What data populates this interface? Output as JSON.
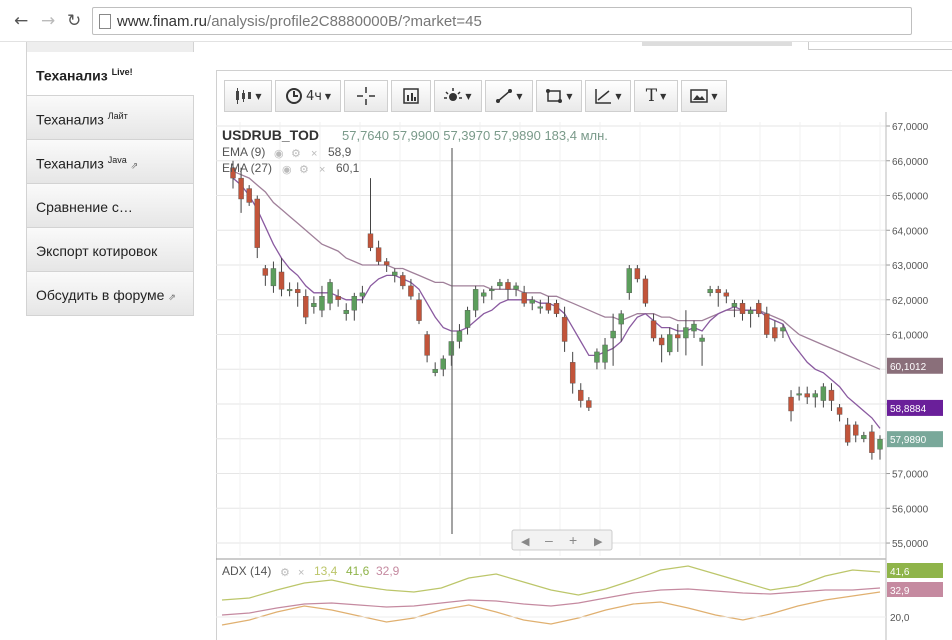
{
  "browser": {
    "back_icon": "back-arrow-icon",
    "forward_icon": "forward-arrow-icon",
    "reload_icon": "reload-icon",
    "url_host": "www.finam.ru",
    "url_path": "/analysis/profile2C8880000B/?market=45"
  },
  "sidebar": {
    "items": [
      {
        "label": "Теханализ",
        "sup": "Live!"
      },
      {
        "label": "Теханализ",
        "sup": "Лайт"
      },
      {
        "label": "Теханализ",
        "sup": "Java",
        "ext": "⇗"
      },
      {
        "label": "Сравнение с…"
      },
      {
        "label": "Экспорт котировок"
      },
      {
        "label": "Обсудить в форуме",
        "ext": "⇗"
      }
    ]
  },
  "toolbar": {
    "period_label": "4ч",
    "text_tool_label": "T"
  },
  "chart_data": {
    "type": "candlestick",
    "ticker": "USDRUB_TOD",
    "ohlc_header": [
      "57,7640",
      "57,9900",
      "57,3970",
      "57,9890",
      "183,4 млн."
    ],
    "indicators": [
      {
        "name": "EMA (9)",
        "value": "58,9",
        "color": "#8a5aa0"
      },
      {
        "name": "EMA (27)",
        "value": "60,1",
        "color": "#a0809a"
      }
    ],
    "ylim": [
      54.8,
      67.0
    ],
    "y_ticks": [
      {
        "value": 67,
        "label": "67,0000"
      },
      {
        "value": 66,
        "label": "66,0000"
      },
      {
        "value": 65,
        "label": "65,0000"
      },
      {
        "value": 64,
        "label": "64,0000"
      },
      {
        "value": 63,
        "label": "63,0000"
      },
      {
        "value": 62,
        "label": "62,0000"
      },
      {
        "value": 61,
        "label": "61,0000"
      },
      {
        "value": 59,
        "label": "59,0000"
      },
      {
        "value": 57,
        "label": "57,0000"
      },
      {
        "value": 56,
        "label": "56,0000"
      },
      {
        "value": 55,
        "label": "55,0000"
      }
    ],
    "price_tags": [
      {
        "value": 60.1012,
        "label": "60,1012",
        "color": "#8a6f7a"
      },
      {
        "value": 58.8884,
        "label": "58,8884",
        "color": "#6a1f9a"
      },
      {
        "value": 57.989,
        "label": "57,9890",
        "color": "#79a89a"
      }
    ],
    "candles": [
      [
        65.8,
        66.0,
        65.2,
        65.5
      ],
      [
        65.5,
        65.8,
        64.5,
        64.9
      ],
      [
        65.2,
        65.3,
        64.7,
        64.8
      ],
      [
        64.9,
        65.0,
        63.2,
        63.5
      ],
      [
        62.9,
        63.0,
        62.4,
        62.7
      ],
      [
        62.4,
        63.1,
        62.2,
        62.9
      ],
      [
        62.8,
        63.2,
        62.1,
        62.3
      ],
      [
        62.3,
        62.5,
        62.1,
        62.3
      ],
      [
        62.3,
        62.5,
        61.8,
        62.2
      ],
      [
        62.1,
        62.3,
        61.3,
        61.5
      ],
      [
        61.8,
        62.1,
        61.6,
        61.9
      ],
      [
        61.7,
        62.4,
        61.5,
        62.1
      ],
      [
        61.9,
        62.6,
        61.7,
        62.5
      ],
      [
        62.1,
        62.3,
        61.8,
        62.0
      ],
      [
        61.6,
        61.9,
        61.4,
        61.7
      ],
      [
        61.7,
        62.2,
        61.4,
        62.1
      ],
      [
        62.1,
        62.4,
        61.9,
        62.2
      ],
      [
        63.9,
        65.5,
        63.4,
        63.5
      ],
      [
        63.5,
        63.7,
        63.0,
        63.1
      ],
      [
        63.1,
        63.2,
        62.8,
        63.0
      ],
      [
        62.7,
        62.9,
        62.5,
        62.8
      ],
      [
        62.7,
        62.8,
        62.3,
        62.4
      ],
      [
        62.4,
        62.6,
        62.0,
        62.1
      ],
      [
        62.0,
        62.2,
        61.3,
        61.4
      ],
      [
        61.0,
        61.1,
        60.2,
        60.4
      ],
      [
        59.9,
        60.2,
        59.8,
        60.0
      ],
      [
        60.0,
        60.4,
        59.8,
        60.3
      ],
      [
        60.4,
        60.8,
        60.1,
        60.8
      ],
      [
        60.8,
        61.3,
        60.6,
        61.1
      ],
      [
        61.2,
        61.8,
        61.0,
        61.7
      ],
      [
        61.7,
        62.4,
        61.5,
        62.3
      ],
      [
        62.1,
        62.3,
        61.9,
        62.2
      ],
      [
        62.3,
        62.4,
        62.0,
        62.3
      ],
      [
        62.4,
        62.6,
        62.3,
        62.5
      ],
      [
        62.5,
        62.6,
        62.0,
        62.3
      ],
      [
        62.3,
        62.5,
        62.1,
        62.4
      ],
      [
        62.2,
        62.4,
        61.8,
        61.9
      ],
      [
        61.9,
        62.1,
        61.7,
        62.0
      ],
      [
        61.8,
        62.0,
        61.6,
        61.8
      ],
      [
        61.9,
        62.1,
        61.6,
        61.7
      ],
      [
        61.9,
        62.0,
        61.5,
        61.6
      ],
      [
        61.5,
        61.8,
        60.5,
        60.8
      ],
      [
        60.2,
        60.5,
        59.3,
        59.6
      ],
      [
        59.4,
        59.6,
        58.9,
        59.1
      ],
      [
        59.1,
        59.2,
        58.8,
        58.9
      ],
      [
        60.2,
        60.6,
        60.0,
        60.5
      ],
      [
        60.2,
        60.9,
        60.0,
        60.7
      ],
      [
        60.9,
        61.6,
        60.1,
        61.1
      ],
      [
        61.3,
        61.7,
        60.8,
        61.6
      ],
      [
        62.2,
        63.0,
        62.0,
        62.9
      ],
      [
        62.9,
        63.0,
        62.5,
        62.6
      ],
      [
        62.6,
        62.7,
        61.8,
        61.9
      ],
      [
        61.4,
        61.6,
        60.8,
        60.9
      ],
      [
        60.9,
        61.0,
        60.2,
        60.7
      ],
      [
        60.5,
        61.2,
        60.4,
        61.0
      ],
      [
        61.0,
        61.3,
        60.5,
        60.9
      ],
      [
        60.9,
        61.7,
        60.4,
        61.2
      ],
      [
        61.1,
        61.4,
        60.9,
        61.3
      ],
      [
        60.8,
        61.0,
        60.1,
        60.9
      ],
      [
        62.2,
        62.4,
        62.1,
        62.3
      ],
      [
        62.3,
        62.4,
        61.8,
        62.2
      ],
      [
        62.2,
        62.3,
        61.9,
        62.1
      ],
      [
        61.8,
        62.0,
        61.5,
        61.9
      ],
      [
        61.9,
        62.0,
        61.4,
        61.6
      ],
      [
        61.6,
        61.8,
        61.2,
        61.7
      ],
      [
        61.9,
        62.0,
        61.5,
        61.6
      ],
      [
        61.6,
        61.8,
        60.9,
        61.0
      ],
      [
        61.2,
        61.4,
        60.8,
        60.9
      ],
      [
        61.1,
        61.3,
        60.9,
        61.2
      ],
      [
        59.2,
        59.4,
        58.5,
        58.8
      ],
      [
        59.3,
        59.5,
        59.1,
        59.3
      ],
      [
        59.3,
        59.5,
        59.0,
        59.2
      ],
      [
        59.2,
        59.4,
        58.9,
        59.3
      ],
      [
        59.1,
        59.6,
        58.9,
        59.5
      ],
      [
        59.4,
        59.6,
        58.8,
        59.1
      ],
      [
        58.9,
        59.0,
        58.5,
        58.7
      ],
      [
        58.4,
        58.6,
        57.8,
        57.9
      ],
      [
        58.4,
        58.5,
        57.9,
        58.1
      ],
      [
        58.0,
        58.2,
        57.9,
        58.1
      ],
      [
        58.2,
        58.4,
        57.4,
        57.6
      ],
      [
        57.7,
        58.1,
        57.4,
        57.989
      ]
    ],
    "ema9": [
      65.5,
      65.3,
      65.0,
      64.6,
      64.1,
      63.6,
      63.2,
      62.9,
      62.7,
      62.4,
      62.2,
      62.2,
      62.2,
      62.1,
      62.0,
      62.0,
      62.0,
      62.4,
      62.6,
      62.7,
      62.7,
      62.6,
      62.5,
      62.3,
      61.9,
      61.5,
      61.2,
      61.1,
      61.1,
      61.2,
      61.4,
      61.6,
      61.7,
      61.9,
      62.0,
      62.0,
      62.0,
      62.0,
      61.9,
      61.9,
      61.8,
      61.6,
      61.2,
      60.8,
      60.4,
      60.4,
      60.5,
      60.6,
      60.8,
      61.2,
      61.5,
      61.6,
      61.4,
      61.2,
      61.2,
      61.1,
      61.1,
      61.2,
      61.1,
      61.4,
      61.6,
      61.7,
      61.8,
      61.7,
      61.7,
      61.7,
      61.5,
      61.4,
      61.3,
      60.8,
      60.5,
      60.2,
      60.0,
      59.9,
      59.7,
      59.5,
      59.2,
      59.0,
      58.8,
      58.6,
      58.3
    ],
    "ema27": [
      65.7,
      65.6,
      65.5,
      65.3,
      65.1,
      64.8,
      64.6,
      64.4,
      64.2,
      64.0,
      63.8,
      63.6,
      63.5,
      63.4,
      63.2,
      63.1,
      63.0,
      63.0,
      63.0,
      63.0,
      62.9,
      62.9,
      62.8,
      62.7,
      62.6,
      62.5,
      62.5,
      62.4,
      62.4,
      62.4,
      62.4,
      62.4,
      62.3,
      62.3,
      62.3,
      62.3,
      62.2,
      62.2,
      62.2,
      62.1,
      62.1,
      62.0,
      61.9,
      61.8,
      61.7,
      61.6,
      61.5,
      61.5,
      61.4,
      61.5,
      61.6,
      61.6,
      61.6,
      61.5,
      61.5,
      61.4,
      61.4,
      61.4,
      61.4,
      61.5,
      61.6,
      61.7,
      61.7,
      61.7,
      61.7,
      61.7,
      61.6,
      61.5,
      61.4,
      61.2,
      61.0,
      60.9,
      60.8,
      60.7,
      60.6,
      60.5,
      60.4,
      60.3,
      60.2,
      60.1,
      60.0
    ],
    "adx": {
      "label": "ADX (14)",
      "values": [
        "13,4",
        "41,6",
        "32,9"
      ],
      "colors": [
        "#bcc66a",
        "#8fb44a",
        "#c58aa0"
      ],
      "tags": [
        {
          "label": "41,6",
          "color": "#8fb44a"
        },
        {
          "label": "32,9",
          "color": "#c58aa0"
        }
      ],
      "y_tick": "20,0"
    }
  }
}
